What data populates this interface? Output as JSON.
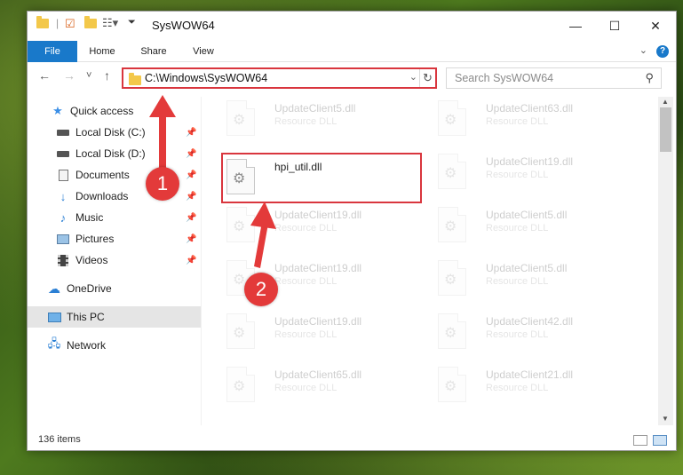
{
  "window": {
    "title": "SysWOW64",
    "minimize": "—",
    "maximize": "☐",
    "close": "✕"
  },
  "ribbon": {
    "tabs": [
      "File",
      "Home",
      "Share",
      "View"
    ],
    "help": "?"
  },
  "nav": {
    "back": "←",
    "forward": "→",
    "recent": "˅",
    "up": "↑",
    "address": "C:\\Windows\\SysWOW64",
    "search_placeholder": "Search SysWOW64"
  },
  "sidebar": {
    "quick_access": "Quick access",
    "items": [
      {
        "label": "Local Disk (C:)",
        "icon": "drive-icon",
        "pinned": true
      },
      {
        "label": "Local Disk (D:)",
        "icon": "drive-icon",
        "pinned": true
      },
      {
        "label": "Documents",
        "icon": "documents-icon",
        "pinned": true
      },
      {
        "label": "Downloads",
        "icon": "download-icon",
        "pinned": true
      },
      {
        "label": "Music",
        "icon": "music-icon",
        "pinned": true
      },
      {
        "label": "Pictures",
        "icon": "pictures-icon",
        "pinned": true
      },
      {
        "label": "Videos",
        "icon": "videos-icon",
        "pinned": true
      }
    ],
    "onedrive": "OneDrive",
    "this_pc": "This PC",
    "network": "Network"
  },
  "files": {
    "highlighted": {
      "name": "hpi_util.dll"
    },
    "faded_left": [
      {
        "name": "UpdateClient5.dll",
        "type": "Resource DLL"
      },
      {
        "name": "UpdateClient19.dll",
        "type": "Resource DLL"
      },
      {
        "name": "UpdateClient19.dll",
        "type": "Resource DLL"
      },
      {
        "name": "UpdateClient19.dll",
        "type": "Resource DLL"
      },
      {
        "name": "UpdateClient65.dll",
        "type": "Resource DLL"
      }
    ],
    "faded_right": [
      {
        "name": "UpdateClient63.dll",
        "type": "Resource DLL"
      },
      {
        "name": "UpdateClient19.dll",
        "type": "Resource DLL"
      },
      {
        "name": "UpdateClient5.dll",
        "type": "Resource DLL"
      },
      {
        "name": "UpdateClient5.dll",
        "type": "Resource DLL"
      },
      {
        "name": "UpdateClient42.dll",
        "type": "Resource DLL"
      },
      {
        "name": "UpdateClient21.dll",
        "type": "Resource DLL"
      }
    ]
  },
  "status": {
    "item_count": "136 items"
  },
  "callouts": {
    "step1": "1",
    "step2": "2"
  },
  "colors": {
    "accent": "#1979ca",
    "highlight_border": "#d9363e",
    "callout": "#e33a3a"
  }
}
